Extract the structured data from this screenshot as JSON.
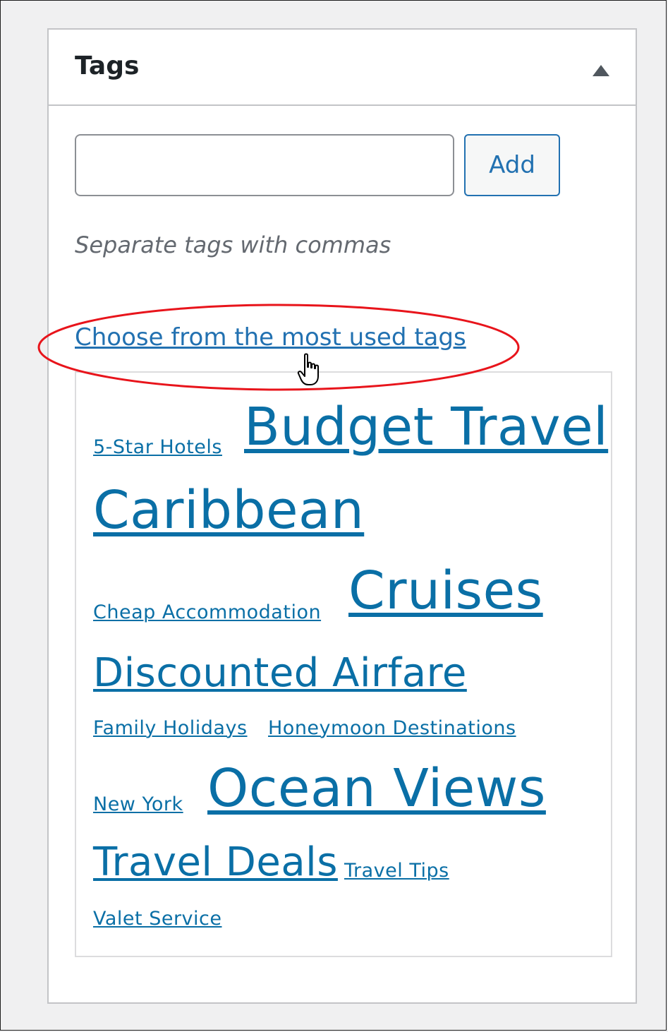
{
  "panel": {
    "title": "Tags",
    "toggle_icon": "triangle-up-icon"
  },
  "tag_input": {
    "value": "",
    "placeholder": ""
  },
  "add_button": {
    "label": "Add"
  },
  "hint": "Separate tags with commas",
  "most_used_link": "Choose from the most used tags",
  "annotation": {
    "shape": "oval-highlight",
    "color": "#e8141b"
  },
  "cursor": "hand-pointer-icon",
  "tag_cloud": {
    "link_color": "#0a6fa6",
    "tags": [
      "5-Star Hotels",
      "Budget Travel",
      "Caribbean",
      "Cheap Accommodation",
      "Cruises",
      "Discounted Airfare",
      "Family Holidays",
      "Honeymoon Destinations",
      "New York",
      "Ocean Views",
      "Travel Deals",
      "Travel Tips",
      "Valet Service"
    ]
  }
}
